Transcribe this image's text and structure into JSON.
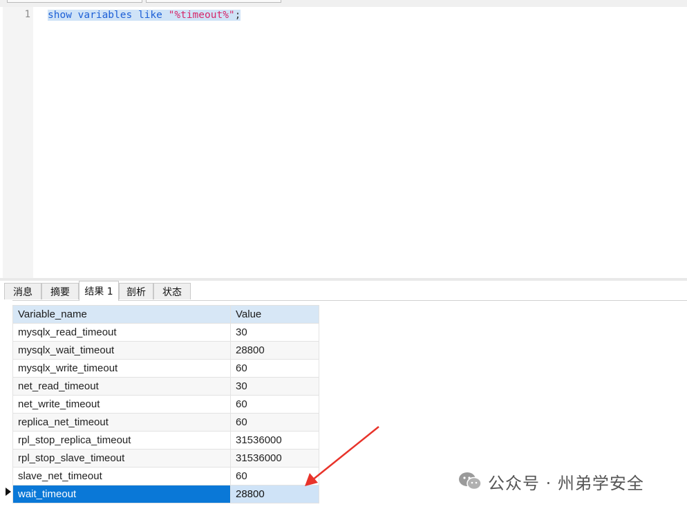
{
  "editor": {
    "line_number": "1",
    "code": {
      "kw1": "show",
      "kw2": "variables",
      "kw3": "like",
      "str": "\"%timeout%\"",
      "end": ";"
    }
  },
  "tabs": [
    {
      "label": "消息"
    },
    {
      "label": "摘要"
    },
    {
      "label": "结果 1",
      "active": true
    },
    {
      "label": "剖析"
    },
    {
      "label": "状态"
    }
  ],
  "results": {
    "columns": [
      "Variable_name",
      "Value"
    ],
    "rows": [
      [
        "mysqlx_read_timeout",
        "30"
      ],
      [
        "mysqlx_wait_timeout",
        "28800"
      ],
      [
        "mysqlx_write_timeout",
        "60"
      ],
      [
        "net_read_timeout",
        "30"
      ],
      [
        "net_write_timeout",
        "60"
      ],
      [
        "replica_net_timeout",
        "60"
      ],
      [
        "rpl_stop_replica_timeout",
        "31536000"
      ],
      [
        "rpl_stop_slave_timeout",
        "31536000"
      ],
      [
        "slave_net_timeout",
        "60"
      ],
      [
        "wait_timeout",
        "28800"
      ]
    ],
    "selected_row": 9
  },
  "watermark": {
    "icon": "wechat-icon",
    "text": "公众号 · 州弟学安全"
  },
  "colors": {
    "selection": "#0a78d7",
    "header": "#d7e7f6",
    "arrow": "#e8332a"
  }
}
